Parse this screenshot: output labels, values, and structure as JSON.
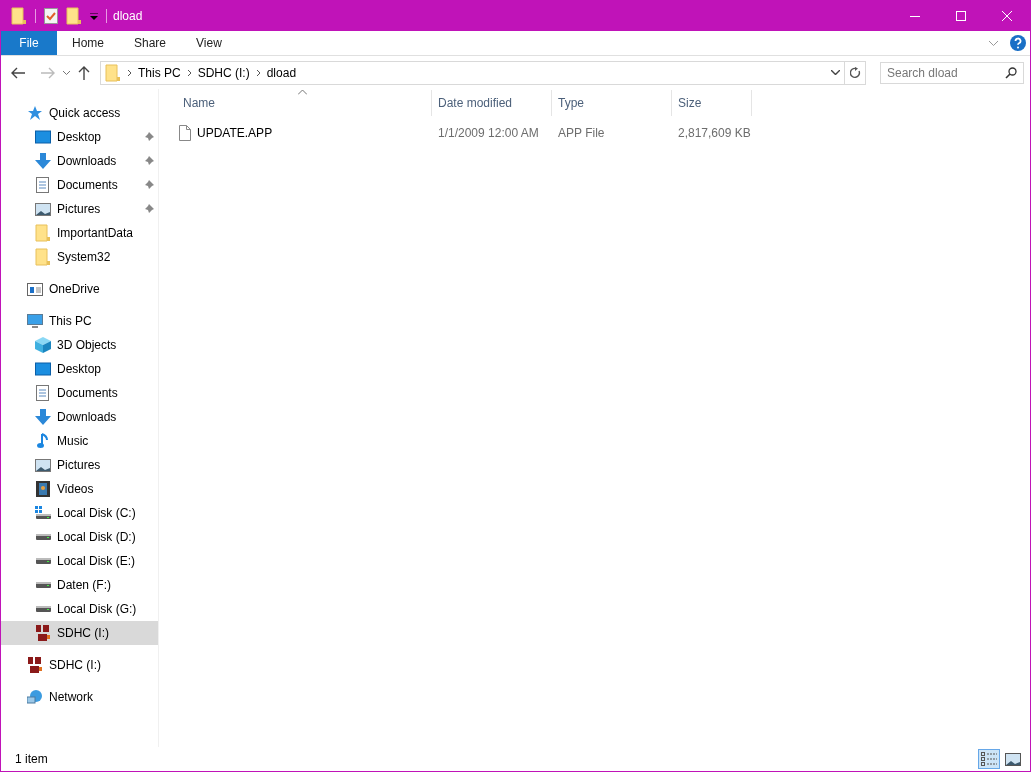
{
  "window": {
    "title": "dload"
  },
  "ribbon": {
    "tabs": [
      {
        "label": "File",
        "selected": true
      },
      {
        "label": "Home",
        "selected": false
      },
      {
        "label": "Share",
        "selected": false
      },
      {
        "label": "View",
        "selected": false
      }
    ]
  },
  "address": {
    "path": [
      "This PC",
      "SDHC (I:)",
      "dload"
    ]
  },
  "search": {
    "placeholder": "Search dload"
  },
  "sidebar": {
    "groups": [
      {
        "label": "Quick access",
        "kind": "star",
        "selected": false,
        "children": [
          {
            "label": "Desktop",
            "kind": "desktop",
            "pinned": true,
            "selected": false
          },
          {
            "label": "Downloads",
            "kind": "downloads",
            "pinned": true,
            "selected": false
          },
          {
            "label": "Documents",
            "kind": "documents",
            "pinned": true,
            "selected": false
          },
          {
            "label": "Pictures",
            "kind": "pictures",
            "pinned": true,
            "selected": false
          },
          {
            "label": "ImportantData",
            "kind": "folder",
            "pinned": false,
            "selected": false
          },
          {
            "label": "System32",
            "kind": "folder",
            "pinned": false,
            "selected": false
          }
        ]
      },
      {
        "label": "OneDrive",
        "kind": "onedrive",
        "selected": false
      },
      {
        "label": "This PC",
        "kind": "pc",
        "selected": false,
        "children": [
          {
            "label": "3D Objects",
            "kind": "objects3d",
            "pinned": false,
            "selected": false
          },
          {
            "label": "Desktop",
            "kind": "desktop",
            "pinned": false,
            "selected": false
          },
          {
            "label": "Documents",
            "kind": "documents",
            "pinned": false,
            "selected": false
          },
          {
            "label": "Downloads",
            "kind": "downloads",
            "pinned": false,
            "selected": false
          },
          {
            "label": "Music",
            "kind": "music",
            "pinned": false,
            "selected": false
          },
          {
            "label": "Pictures",
            "kind": "pictures",
            "pinned": false,
            "selected": false
          },
          {
            "label": "Videos",
            "kind": "videos",
            "pinned": false,
            "selected": false
          },
          {
            "label": "Local Disk (C:)",
            "kind": "disk-windows",
            "pinned": false,
            "selected": false
          },
          {
            "label": "Local Disk (D:)",
            "kind": "disk",
            "pinned": false,
            "selected": false
          },
          {
            "label": "Local Disk (E:)",
            "kind": "disk",
            "pinned": false,
            "selected": false
          },
          {
            "label": "Daten (F:)",
            "kind": "disk",
            "pinned": false,
            "selected": false
          },
          {
            "label": "Local Disk (G:)",
            "kind": "disk",
            "pinned": false,
            "selected": false
          },
          {
            "label": "SDHC (I:)",
            "kind": "sd",
            "pinned": false,
            "selected": true
          }
        ]
      },
      {
        "label": "SDHC (I:)",
        "kind": "sd",
        "selected": false
      },
      {
        "label": "Network",
        "kind": "network",
        "selected": false
      }
    ]
  },
  "table": {
    "columns": [
      "Name",
      "Date modified",
      "Type",
      "Size"
    ],
    "rows": [
      {
        "name": "UPDATE.APP",
        "date": "1/1/2009 12:00 AM",
        "type": "APP File",
        "size": "2,817,609 KB",
        "selected": false
      }
    ]
  },
  "status_bar": {
    "count": "1 item",
    "views": [
      {
        "kind": "details",
        "selected": true
      },
      {
        "kind": "thumbnails",
        "selected": false
      }
    ]
  }
}
